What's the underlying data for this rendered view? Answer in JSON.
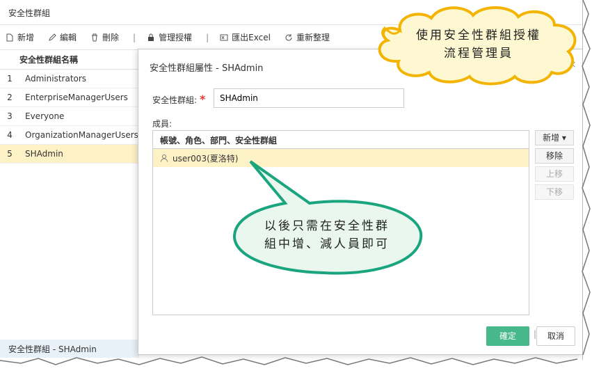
{
  "window_title": "安全性群組",
  "toolbar": {
    "add": "新增",
    "edit": "編輯",
    "delete": "刪除",
    "manage_auth": "管理授權",
    "export_excel": "匯出Excel",
    "reorder": "重新整理"
  },
  "grid": {
    "header": "安全性群組名稱",
    "rows": [
      {
        "num": "1",
        "name": "Administrators"
      },
      {
        "num": "2",
        "name": "EnterpriseManagerUsers"
      },
      {
        "num": "3",
        "name": "Everyone"
      },
      {
        "num": "4",
        "name": "OrganizationManagerUsers"
      },
      {
        "num": "5",
        "name": "SHAdmin"
      }
    ]
  },
  "statusbar": "安全性群組 - SHAdmin",
  "dialog": {
    "title": "安全性群組屬性 - SHAdmin",
    "group_label": "安全性群組:",
    "required_mark": "*",
    "group_value": "SHAdmin",
    "members_label": "成員:",
    "members_header": "帳號、角色、部門、安全性群組",
    "members": [
      {
        "name": "user003(夏洛特)"
      }
    ],
    "add_btn": "新增 ▾",
    "remove_btn": "移除",
    "up_btn": "上移",
    "down_btn": "下移",
    "ok_btn": "確定",
    "cancel_btn": "取消",
    "separator": "|",
    "close": "×"
  },
  "callouts": {
    "top": [
      "使用安全性群組授權",
      "流程管理員"
    ],
    "bottom": [
      "以後只需在安全性群",
      "組中增、減人員即可"
    ]
  },
  "colors": {
    "selected_row": "#fdf1c6",
    "ok_button": "#46b88a",
    "callout_border_top": "#f2b400",
    "callout_border_bottom": "#1aa57f"
  }
}
